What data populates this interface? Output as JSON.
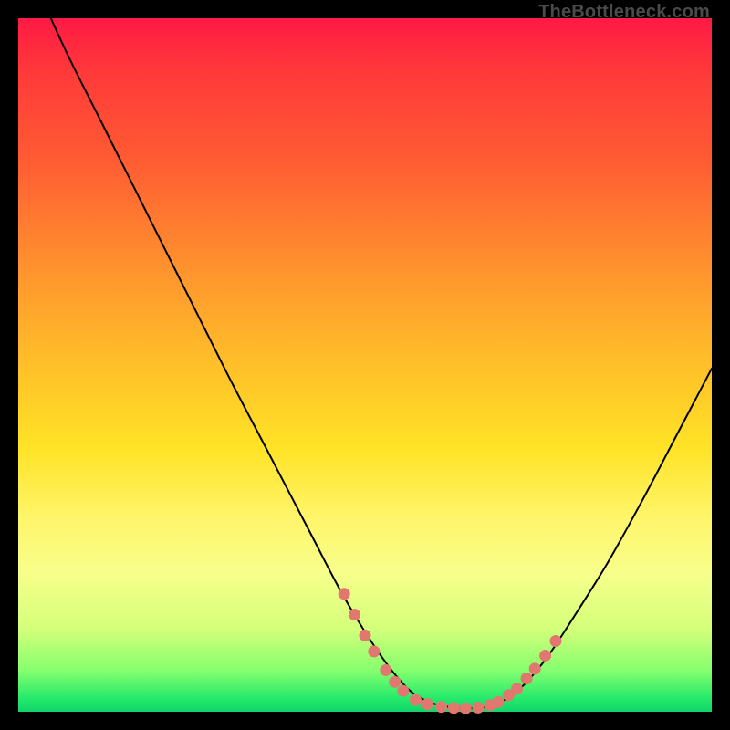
{
  "watermark": "TheBottleneck.com",
  "colors": {
    "background": "#000000",
    "curve_stroke": "#000000",
    "marker_fill": "#e1776e",
    "marker_stroke": "#e1776e"
  },
  "chart_data": {
    "type": "line",
    "title": "",
    "xlabel": "",
    "ylabel": "",
    "xlim": [
      0,
      100
    ],
    "ylim": [
      0,
      100
    ],
    "grid": false,
    "series": [
      {
        "name": "bottleneck-curve",
        "x": [
          0,
          3,
          7,
          12,
          18,
          24,
          30,
          36,
          42,
          47,
          52,
          56,
          59,
          62,
          65,
          67,
          69,
          72,
          76,
          80,
          85,
          90,
          95,
          100
        ],
        "y": [
          112,
          104,
          95,
          85,
          73,
          61,
          49,
          37.5,
          26,
          16.5,
          8.5,
          3.5,
          1.5,
          0.7,
          0.5,
          0.6,
          1.2,
          3.0,
          7.5,
          13.5,
          21.5,
          30.5,
          40,
          49.5
        ]
      }
    ],
    "markers": {
      "name": "highlight-points",
      "points": [
        {
          "x": 47.0,
          "y": 17.0
        },
        {
          "x": 48.5,
          "y": 14.0
        },
        {
          "x": 50.0,
          "y": 11.0
        },
        {
          "x": 51.3,
          "y": 8.7
        },
        {
          "x": 53.0,
          "y": 6.0
        },
        {
          "x": 54.3,
          "y": 4.3
        },
        {
          "x": 55.5,
          "y": 3.0
        },
        {
          "x": 57.3,
          "y": 1.7
        },
        {
          "x": 59.0,
          "y": 1.1
        },
        {
          "x": 61.0,
          "y": 0.7
        },
        {
          "x": 62.8,
          "y": 0.55
        },
        {
          "x": 64.5,
          "y": 0.5
        },
        {
          "x": 66.3,
          "y": 0.6
        },
        {
          "x": 68.0,
          "y": 0.95
        },
        {
          "x": 69.2,
          "y": 1.4
        },
        {
          "x": 70.7,
          "y": 2.4
        },
        {
          "x": 71.9,
          "y": 3.3
        },
        {
          "x": 73.3,
          "y": 4.8
        },
        {
          "x": 74.5,
          "y": 6.2
        },
        {
          "x": 76.0,
          "y": 8.1
        },
        {
          "x": 77.5,
          "y": 10.2
        }
      ]
    }
  }
}
